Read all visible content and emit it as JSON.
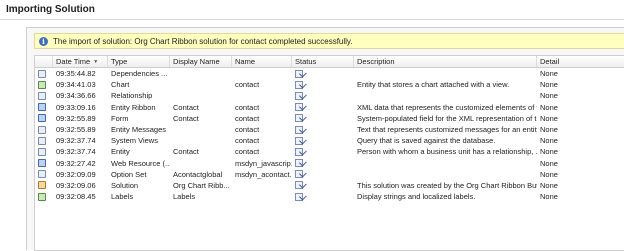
{
  "page": {
    "title": "Importing Solution"
  },
  "notice": {
    "icon": "info-icon",
    "text": "The import of solution: Org Chart Ribbon solution for contact completed successfully."
  },
  "grid": {
    "columns": {
      "datetime": "Date Time",
      "type": "Type",
      "display_name": "Display Name",
      "name": "Name",
      "status": "Status",
      "description": "Description",
      "detail": "Detail"
    },
    "rows": [
      {
        "datetime": "09:35:44.82",
        "type": "Dependencies ...",
        "display_name": "",
        "name": "",
        "description": "",
        "detail": "None",
        "icon": "dependencies-icon"
      },
      {
        "datetime": "09:34:41.03",
        "type": "Chart",
        "display_name": "",
        "name": "contact",
        "description": "Entity that stores a chart attached with a view.",
        "detail": "None",
        "icon": "chart-icon"
      },
      {
        "datetime": "09:34:36.66",
        "type": "Relationship",
        "display_name": "",
        "name": "",
        "description": "",
        "detail": "None",
        "icon": "relationship-icon"
      },
      {
        "datetime": "09:33:09.16",
        "type": "Entity Ribbon",
        "display_name": "Contact",
        "name": "contact",
        "description": "XML data that represents the customized elements of t...",
        "detail": "None",
        "icon": "entity-ribbon-icon"
      },
      {
        "datetime": "09:32:55.89",
        "type": "Form",
        "display_name": "Contact",
        "name": "contact",
        "description": "System-populated field for the XML representation of t...",
        "detail": "None",
        "icon": "form-icon"
      },
      {
        "datetime": "09:32:55.89",
        "type": "Entity Messages",
        "display_name": "",
        "name": "contact",
        "description": "Text that represents customized messages for an entity.",
        "detail": "None",
        "icon": "entity-messages-icon"
      },
      {
        "datetime": "09:32:37.74",
        "type": "System Views",
        "display_name": "",
        "name": "contact",
        "description": "Query that is saved against the database.",
        "detail": "None",
        "icon": "system-views-icon"
      },
      {
        "datetime": "09:32:37.74",
        "type": "Entity",
        "display_name": "Contact",
        "name": "contact",
        "description": "Person with whom a business unit has a relationship, ...",
        "detail": "None",
        "icon": "entity-icon"
      },
      {
        "datetime": "09:32:27.42",
        "type": "Web Resource (...",
        "display_name": "",
        "name": "msdyn_javascrip...",
        "description": "",
        "detail": "None",
        "icon": "web-resource-icon"
      },
      {
        "datetime": "09:32:09.09",
        "type": "Option Set",
        "display_name": "Acontactglobal",
        "name": "msdyn_acontact...",
        "description": "",
        "detail": "None",
        "icon": "option-set-icon"
      },
      {
        "datetime": "09:32:09.06",
        "type": "Solution",
        "display_name": "Org Chart Ribb...",
        "name": "",
        "description": "This solution was created by the Org Chart Ribbon But...",
        "detail": "None",
        "icon": "solution-icon"
      },
      {
        "datetime": "09:32:08.45",
        "type": "Labels",
        "display_name": "Labels",
        "name": "",
        "description": "Display strings and localized labels.",
        "detail": "None",
        "icon": "labels-icon"
      }
    ],
    "status_icon": "success-status-icon"
  }
}
